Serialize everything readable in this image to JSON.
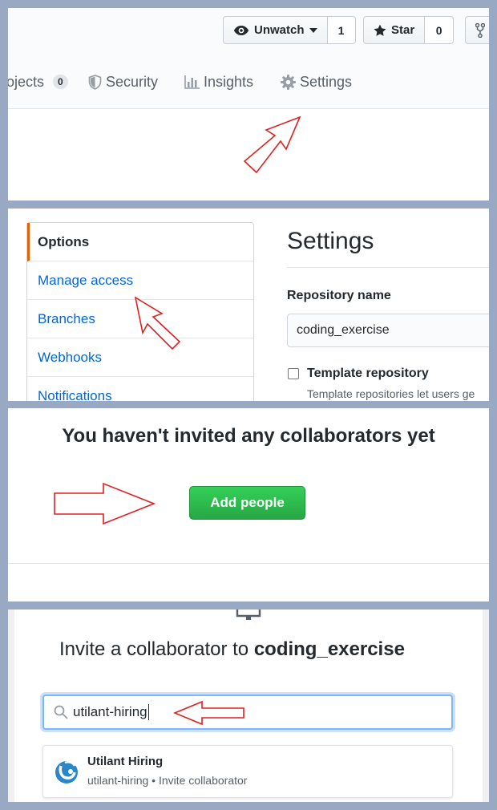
{
  "header": {
    "watch": {
      "label": "Unwatch",
      "count": "1"
    },
    "star": {
      "label": "Star",
      "count": "0"
    }
  },
  "tabs": {
    "projects": {
      "label": "ojects",
      "count": "0"
    },
    "security": {
      "label": "Security"
    },
    "insights": {
      "label": "Insights"
    },
    "settings": {
      "label": "Settings"
    }
  },
  "settings_page": {
    "menu": [
      "Options",
      "Manage access",
      "Branches",
      "Webhooks",
      "Notifications"
    ],
    "title": "Settings",
    "repo_name_label": "Repository name",
    "repo_name_value": "coding_exercise",
    "template_label": "Template repository",
    "template_desc": "Template repositories let users ge"
  },
  "collaborators": {
    "empty_title": "You haven't invited any collaborators yet",
    "add_button": "Add people"
  },
  "invite": {
    "title_prefix": "Invite a collaborator to ",
    "repo": "coding_exercise",
    "search_value": "utilant-hiring",
    "result_name": "Utilant Hiring",
    "result_sub": "utilant-hiring • Invite collaborator"
  },
  "colors": {
    "annotation_arrow": "#e02020",
    "primary_button": "#28a745",
    "link": "#0366d6",
    "selected_accent": "#e36209",
    "background": "#99a9c3"
  },
  "icons": [
    "eye-icon",
    "caret-down-icon",
    "star-icon",
    "fork-icon",
    "shield-icon",
    "graph-icon",
    "gear-icon",
    "search-icon",
    "utilant-logo-icon",
    "annotation-arrow-icon"
  ]
}
